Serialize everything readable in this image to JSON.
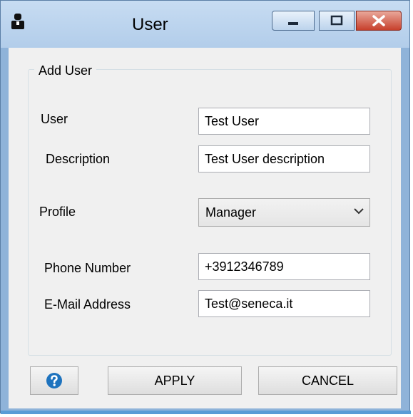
{
  "window": {
    "title": "User",
    "app_icon": "user-icon",
    "controls": {
      "minimize": "minimize-icon",
      "maximize": "maximize-icon",
      "close": "close-icon"
    }
  },
  "group": {
    "legend": "Add User"
  },
  "fields": {
    "user": {
      "label": "User",
      "value": "Test User"
    },
    "description": {
      "label": "Description",
      "value": "Test User description"
    },
    "profile": {
      "label": "Profile",
      "value": "Manager"
    },
    "phone": {
      "label": "Phone Number",
      "value": "+3912346789"
    },
    "email": {
      "label": "E-Mail Address",
      "value": "Test@seneca.it"
    }
  },
  "buttons": {
    "help_icon": "help-icon",
    "apply": "APPLY",
    "cancel": "CANCEL"
  },
  "colors": {
    "titlebar": "#b9d1ea",
    "close_button": "#c7402c",
    "help_icon": "#1e73be",
    "client_background": "#f0f0f0"
  }
}
